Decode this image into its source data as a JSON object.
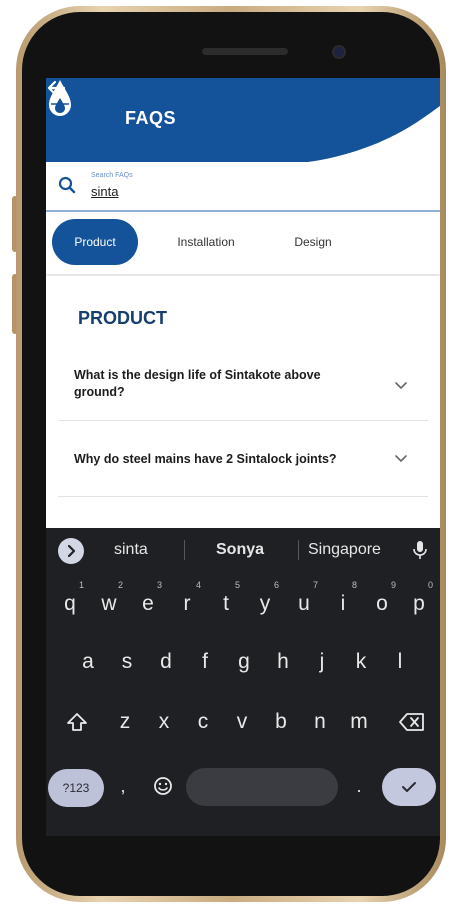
{
  "header": {
    "title": "FAQS",
    "back_icon": "arrow-left-icon",
    "logo_icon": "water-drop-icon",
    "bg_color": "#14539a"
  },
  "search": {
    "label": "Search FAQs",
    "value": "sinta"
  },
  "tabs": [
    {
      "label": "Product",
      "active": true
    },
    {
      "label": "Installation",
      "active": false
    },
    {
      "label": "Design",
      "active": false
    }
  ],
  "section": {
    "title": "PRODUCT"
  },
  "faqs": [
    {
      "question": "What is the design life of Sintakote above ground?"
    },
    {
      "question": "Why do steel mains have 2 Sintalock joints?"
    }
  ],
  "keyboard": {
    "suggestions": [
      "sinta",
      "Sonya",
      "Singapore"
    ],
    "row1": [
      {
        "key": "q",
        "hint": "1"
      },
      {
        "key": "w",
        "hint": "2"
      },
      {
        "key": "e",
        "hint": "3"
      },
      {
        "key": "r",
        "hint": "4"
      },
      {
        "key": "t",
        "hint": "5"
      },
      {
        "key": "y",
        "hint": "6"
      },
      {
        "key": "u",
        "hint": "7"
      },
      {
        "key": "i",
        "hint": "8"
      },
      {
        "key": "o",
        "hint": "9"
      },
      {
        "key": "p",
        "hint": "0"
      }
    ],
    "row2": [
      "a",
      "s",
      "d",
      "f",
      "g",
      "h",
      "j",
      "k",
      "l"
    ],
    "row3": [
      "z",
      "x",
      "c",
      "v",
      "b",
      "n",
      "m"
    ],
    "sym_label": "?123",
    "comma": ",",
    "period": ".",
    "emoji_icon": "emoji-icon"
  }
}
